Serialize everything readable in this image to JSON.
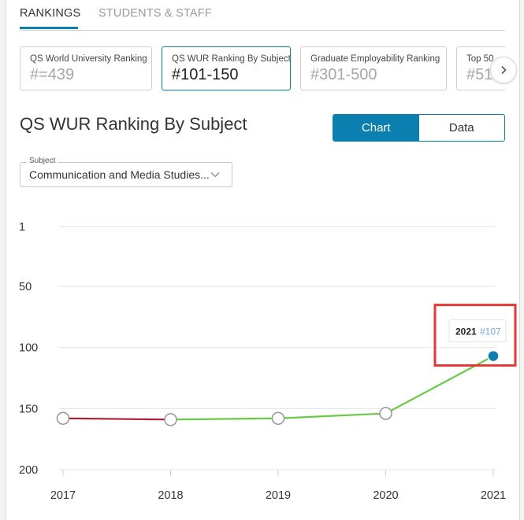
{
  "tabs": [
    {
      "label": "RANKINGS",
      "active": true
    },
    {
      "label": "STUDENTS & STAFF",
      "active": false
    }
  ],
  "cards": [
    {
      "title": "QS World University Ranking",
      "value": "#=439",
      "active": false
    },
    {
      "title": "QS WUR Ranking By Subject",
      "value": "#101-150",
      "active": true
    },
    {
      "title": "Graduate Employability Ranking",
      "value": "#301-500",
      "active": false
    },
    {
      "title": "Top 50",
      "value": "#51",
      "active": false
    }
  ],
  "next_icon": "chevron-right-icon",
  "title": "QS WUR Ranking By Subject",
  "view_toggle": {
    "chart_label": "Chart",
    "data_label": "Data",
    "selected": "Chart"
  },
  "subject_select": {
    "label": "Subject",
    "value": "Communication and Media Studies..."
  },
  "colors": {
    "accent": "#0a7fb0",
    "line_up": "#66cc44",
    "line_down": "#b01c2e",
    "highlight_box": "#e53935"
  },
  "chart_data": {
    "type": "line",
    "x": [
      "2017",
      "2018",
      "2019",
      "2020",
      "2021"
    ],
    "y": [
      158,
      159,
      158,
      154,
      107
    ],
    "y_axis": {
      "ticks": [
        1,
        50,
        100,
        150,
        200
      ],
      "reversed": true,
      "range": [
        1,
        200
      ]
    },
    "grid": true,
    "tooltip": {
      "year": "2021",
      "rank": "#107"
    }
  }
}
